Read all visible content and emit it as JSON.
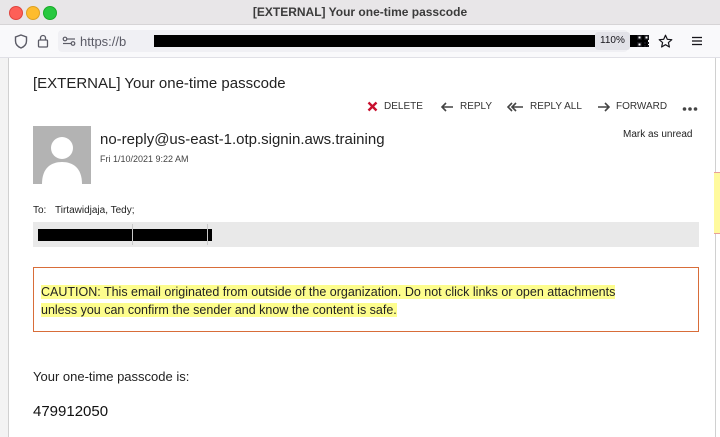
{
  "window": {
    "title": "[EXTERNAL] Your one-time passcode"
  },
  "toolbar": {
    "url_prefix": "https://b",
    "zoom": "110%"
  },
  "email": {
    "subject": "[EXTERNAL] Your one-time passcode",
    "actions": {
      "delete": "DELETE",
      "reply": "REPLY",
      "reply_all": "REPLY ALL",
      "forward": "FORWARD"
    },
    "sender": "no-reply@us-east-1.otp.signin.aws.training",
    "date": "Fri 1/10/2021 9:22 AM",
    "mark_unread": "Mark as unread",
    "to_label": "To:",
    "to_value": "Tirtawidjaja, Tedy;",
    "caution_label": "CAUTION",
    "caution_text_line1": ": This email originated from outside of the organization. Do not click links or open attachments",
    "caution_text_line2": "unless you can confirm the sender and know the content is safe.",
    "body_line": "Your one-time passcode is:",
    "passcode": "479912050"
  },
  "colors": {
    "caution_border": "#d86d39",
    "highlight": "#fdfd8d",
    "delete_red": "#c8102e",
    "avatar_gray": "#b3b3b3"
  },
  "icons": {
    "shield": "shield-icon",
    "lock": "lock-icon",
    "permissions": "permissions-icon",
    "qr": "qr-code-icon",
    "bookmark": "star-icon",
    "menu": "hamburger-menu-icon"
  }
}
